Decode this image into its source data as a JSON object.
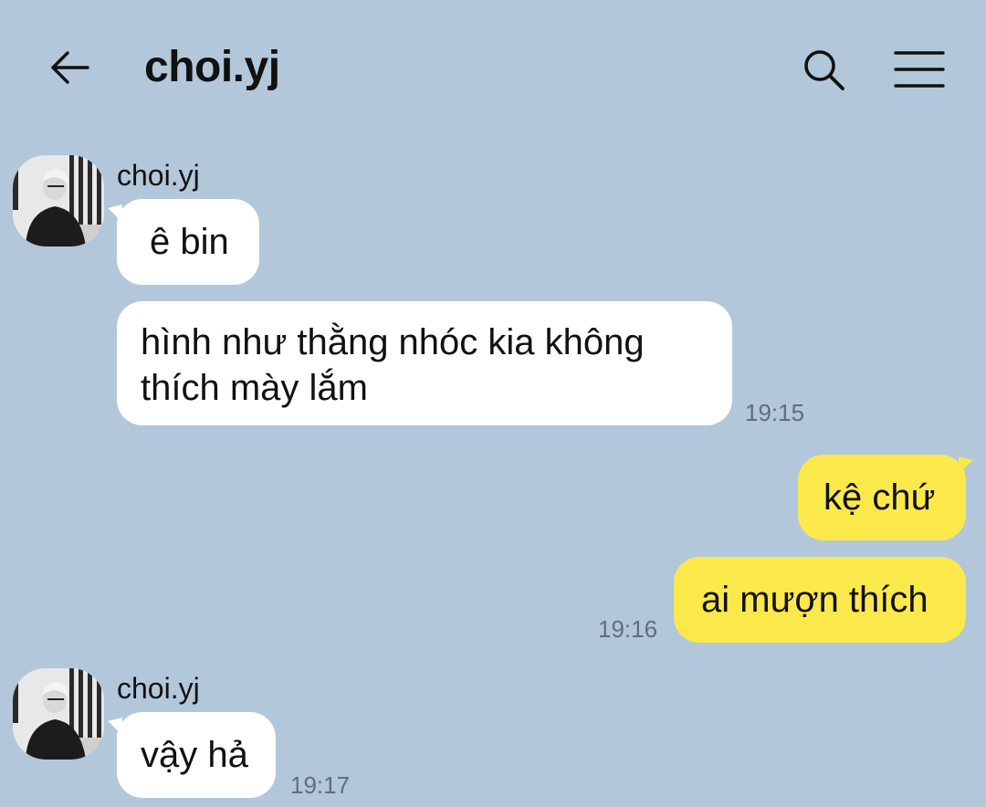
{
  "header": {
    "back_icon": "arrow-left-icon",
    "title": "choi.yj",
    "search_icon": "search-icon",
    "menu_icon": "hamburger-menu-icon"
  },
  "colors": {
    "background": "#b2c7da",
    "incoming_bubble": "#ffffff",
    "outgoing_bubble": "#fbe94c",
    "timestamp": "#5f6e7d"
  },
  "messages": {
    "group1": {
      "sender": "choi.yj",
      "bubble1": "ê bin",
      "bubble2_line1": "hình như thằng nhóc kia không",
      "bubble2_line2": "thích mày lắm",
      "time": "19:15"
    },
    "group2": {
      "bubble1": "kệ chứ",
      "bubble2": "ai mượn thích",
      "time": "19:16"
    },
    "group3": {
      "sender": "choi.yj",
      "bubble1": "vậy hả",
      "time": "19:17"
    }
  }
}
